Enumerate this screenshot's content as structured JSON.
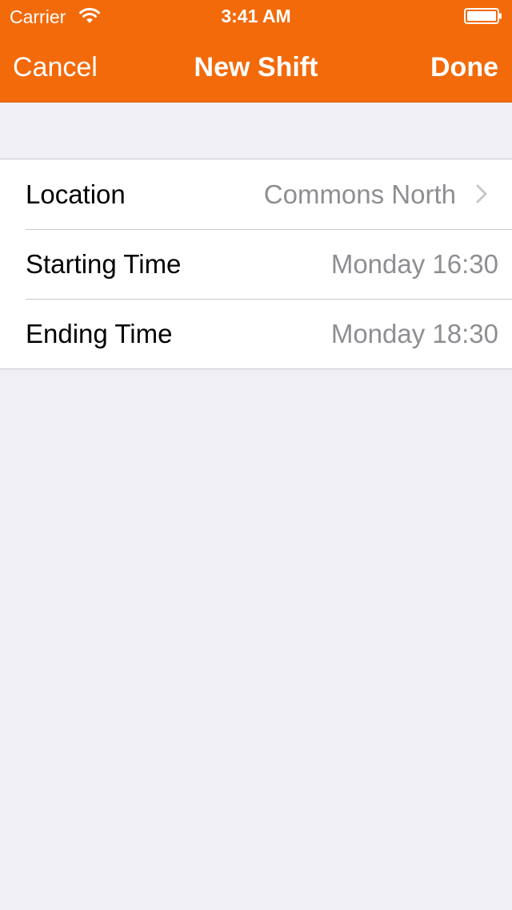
{
  "status_bar": {
    "carrier": "Carrier",
    "time": "3:41 AM",
    "wifi_icon": "wifi-icon",
    "battery_icon": "battery-icon"
  },
  "nav": {
    "cancel_label": "Cancel",
    "title": "New Shift",
    "done_label": "Done",
    "bar_color": "#f36a0a"
  },
  "form": {
    "rows": [
      {
        "label": "Location",
        "value": "Commons North",
        "icon": "chevron-right-icon"
      },
      {
        "label": "Starting Time",
        "value": "Monday 16:30"
      },
      {
        "label": "Ending Time",
        "value": "Monday 18:30"
      }
    ]
  },
  "colors": {
    "accent": "#f36a0a",
    "background": "#efeff4",
    "value_text": "#8e8e93",
    "separator": "#c8c7cc"
  }
}
